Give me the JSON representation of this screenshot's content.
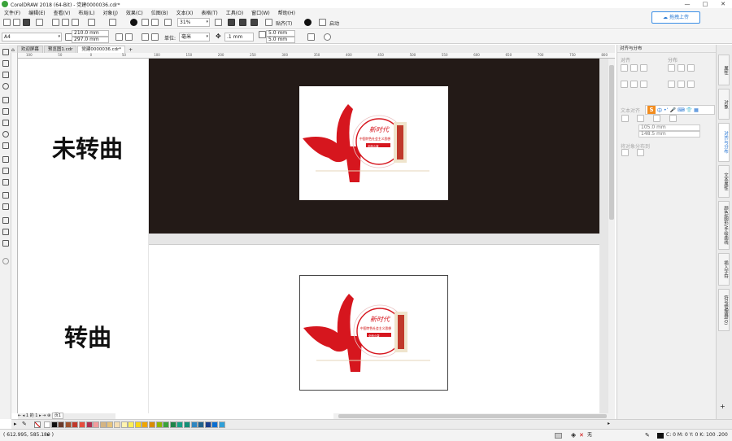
{
  "window": {
    "title": "CorelDRAW 2018 (64-Bit) - 党建0000036.cdr*",
    "controls": [
      "—",
      "□",
      "✕"
    ]
  },
  "menu": [
    "文件(F)",
    "编辑(E)",
    "查看(V)",
    "布局(L)",
    "对象(J)",
    "效果(C)",
    "位图(B)",
    "文本(X)",
    "表格(T)",
    "工具(O)",
    "窗口(W)",
    "帮助(H)"
  ],
  "toolbar": {
    "zoom": "31%",
    "snap_label": "贴齐(T)",
    "launch_label": "启动",
    "upload_button": "拖拽上传"
  },
  "propbar": {
    "page_size": "A4",
    "width": "210.0 mm",
    "height": "297.0 mm",
    "units_label": "单位:",
    "units": "毫米",
    "nudge": ".1 mm",
    "dup_x": "5.0 mm",
    "dup_y": "5.0 mm"
  },
  "tabs": [
    "欢迎屏幕",
    "预览图1.cdr",
    "党建0000036.cdr*"
  ],
  "ruler_ticks": [
    "100",
    "50",
    "0",
    "50",
    "100",
    "150",
    "200",
    "250",
    "300",
    "350",
    "400",
    "450",
    "500",
    "550",
    "600",
    "650",
    "700",
    "750",
    "800"
  ],
  "canvas": {
    "label_top": "未转曲",
    "label_bottom": "转曲"
  },
  "artwork": {
    "headline": "新时代",
    "subtitle": "中国特色社会主义思想",
    "tag": "全面小康"
  },
  "docker": {
    "title": "对齐与分布",
    "align_label": "对齐",
    "distribute_label": "分布",
    "text_align_label": "文本对齐",
    "x_field": "105.0 mm",
    "y_field": "148.5 mm",
    "spacing_label": "将对象分布到"
  },
  "right_tabs": [
    "属性",
    "对象",
    "对齐与分布",
    "文本属性",
    "颜色/图形/手绘曲线",
    "插入字符",
    "符号管理器(Q)"
  ],
  "page_nav": {
    "current": "1",
    "of_label": "的",
    "total": "1",
    "page_tab": "页1"
  },
  "status": {
    "cursor": "( 612.995, 585.180 )",
    "fill_label": "无",
    "outline": "C: 0 M: 0 Y: 0 K: 100  .200 mm"
  },
  "palette_colors": [
    "#ffffff",
    "#111111",
    "#6b3a2a",
    "#a0522d",
    "#c0392b",
    "#e74c3c",
    "#b03050",
    "#f39c9c",
    "#d4b483",
    "#e6c27a",
    "#f5deb3",
    "#fff3b0",
    "#fcef5a",
    "#f7d716",
    "#f0a500",
    "#d98c00",
    "#8db600",
    "#3aa23a",
    "#1e8449",
    "#16a085",
    "#148f77",
    "#2e86c1",
    "#1f618d",
    "#1a3e8c",
    "#0a6ed1",
    "#2f9fd8"
  ]
}
